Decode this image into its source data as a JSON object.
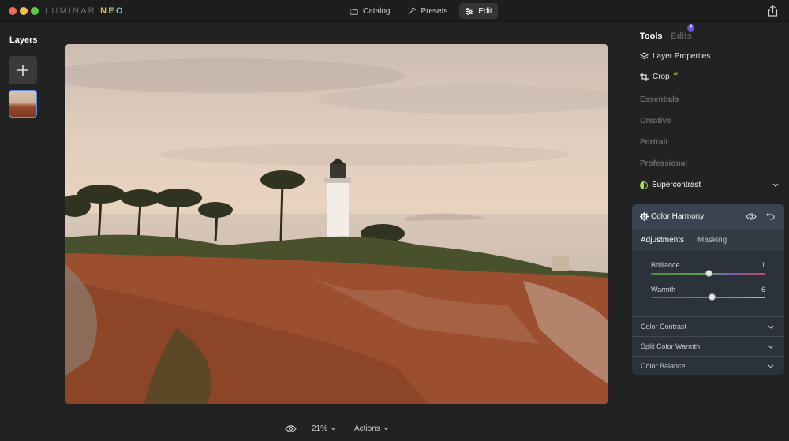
{
  "app": {
    "logo_main": "LUMINAR ",
    "logo_accent": "NEO"
  },
  "topnav": {
    "catalog": "Catalog",
    "presets": "Presets",
    "edit": "Edit",
    "active": "Edit"
  },
  "layers": {
    "title": "Layers"
  },
  "bottombar": {
    "zoom": "21%",
    "actions": "Actions"
  },
  "panel": {
    "tabs": {
      "tools": "Tools",
      "edits": "Edits",
      "edits_badge": "2"
    },
    "tools": {
      "layer_properties": "Layer Properties",
      "crop": "Crop",
      "crop_ai": "AI"
    },
    "categories": {
      "essentials": "Essentials",
      "creative": "Creative",
      "portrait": "Portrait",
      "professional": "Professional"
    },
    "supercontrast": "Supercontrast",
    "color_harmony": {
      "title": "Color Harmony",
      "subtabs": {
        "adjustments": "Adjustments",
        "masking": "Masking",
        "active": "Adjustments"
      },
      "sliders": {
        "brilliance": {
          "label": "Brilliance",
          "value": "1"
        },
        "warmth": {
          "label": "Warmth",
          "value": "6"
        }
      },
      "sections": {
        "color_contrast": "Color Contrast",
        "split_color_warmth": "Split Color Warmth",
        "color_balance": "Color Balance"
      }
    }
  },
  "colors": {
    "accent_blue": "#5c8fe0",
    "badge_purple": "#6a55d6",
    "ai_yellow": "#e5c145",
    "supercontrast_green": "#9fe24a"
  }
}
